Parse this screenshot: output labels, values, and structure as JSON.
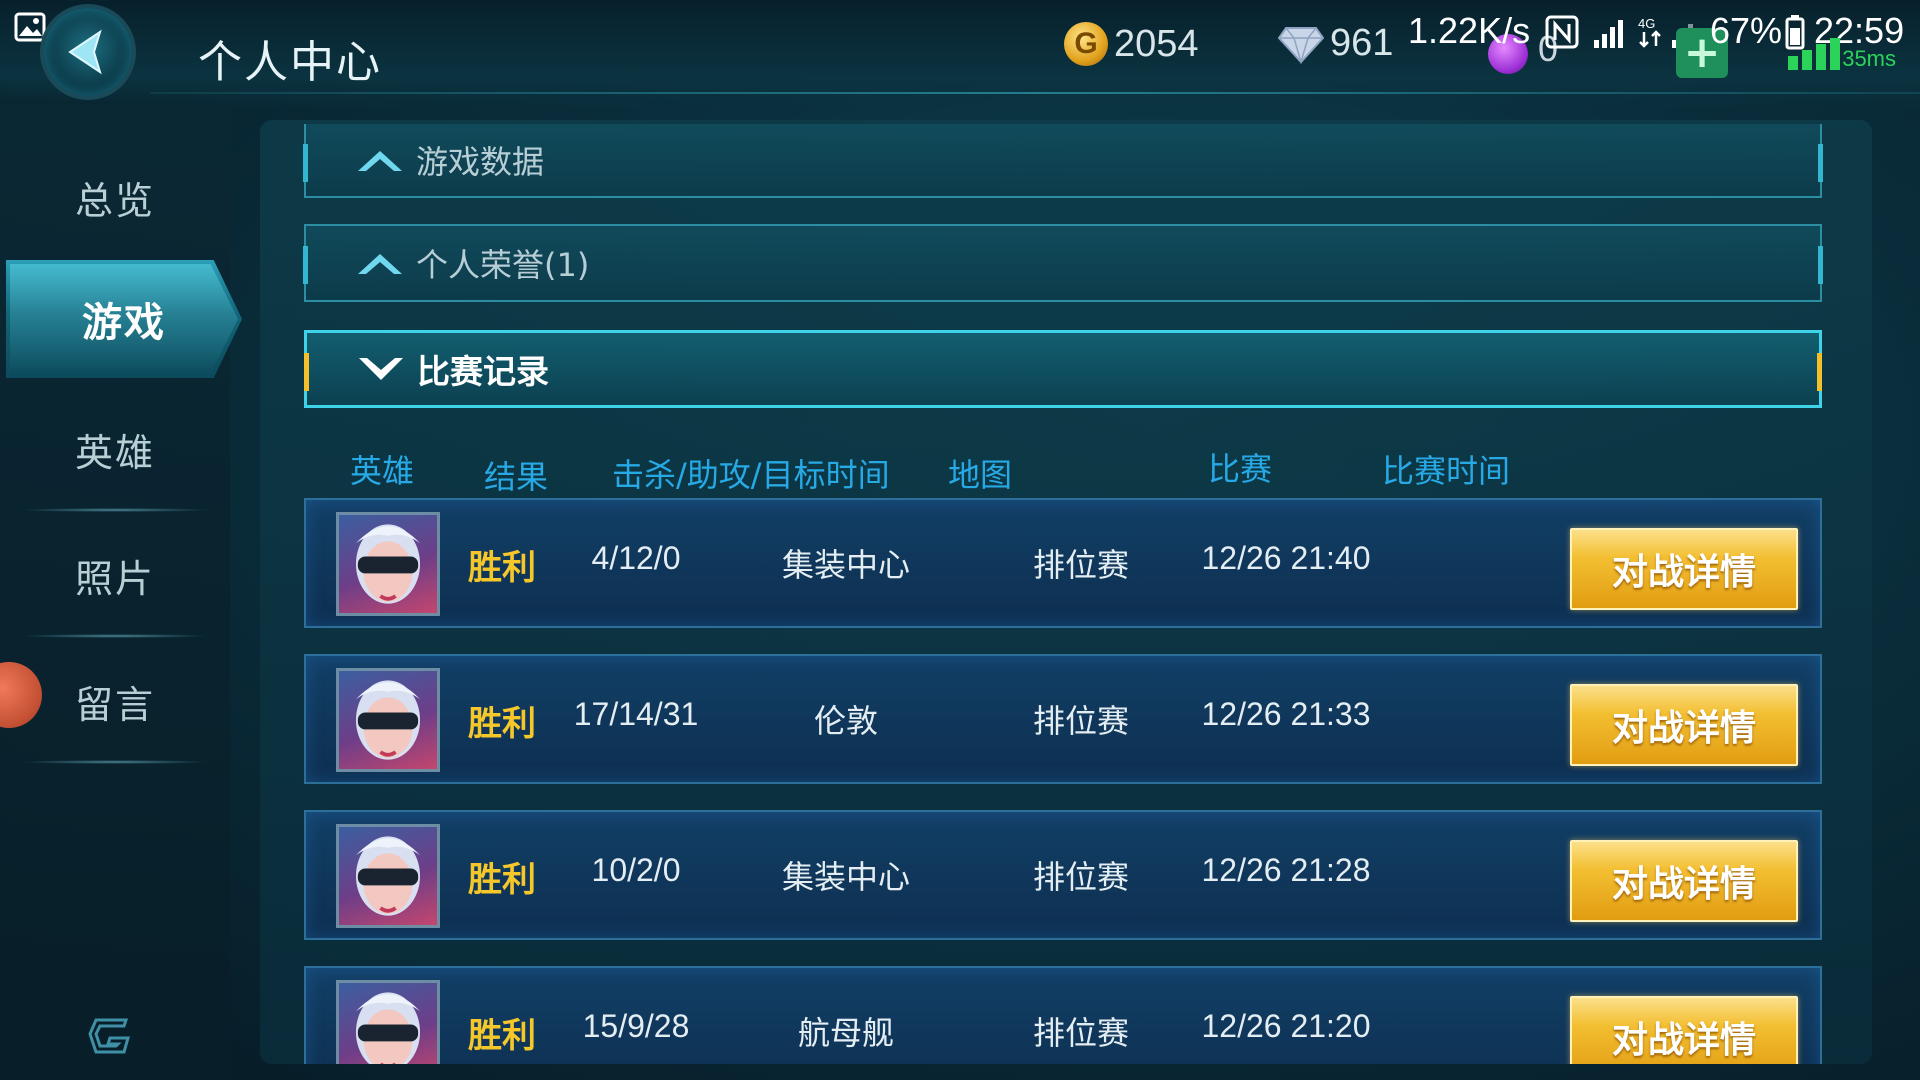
{
  "status_bar": {
    "net_speed": "1.22K/s",
    "battery": "67%",
    "time": "22:59",
    "ping": "35ms"
  },
  "header": {
    "title": "个人中心",
    "gold": "2054",
    "diamonds": "961",
    "purple_gems": "0"
  },
  "sidebar": {
    "items": [
      {
        "label": "总览"
      },
      {
        "label": "游戏"
      },
      {
        "label": "英雄"
      },
      {
        "label": "照片"
      },
      {
        "label": "留言"
      }
    ],
    "active_index": 1
  },
  "sections": [
    {
      "label": "游戏数据",
      "expanded": false
    },
    {
      "label": "个人荣誉(1)",
      "expanded": false
    },
    {
      "label": "比赛记录",
      "expanded": true
    }
  ],
  "match_table": {
    "headers": [
      "英雄",
      "结果",
      "击杀/助攻/目标时间",
      "地图",
      "比赛",
      "比赛时间"
    ],
    "rows": [
      {
        "result": "胜利",
        "kda": "4/12/0",
        "map": "集装中心",
        "mode": "排位赛",
        "time": "12/26 21:40",
        "button": "对战详情"
      },
      {
        "result": "胜利",
        "kda": "17/14/31",
        "map": "伦敦",
        "mode": "排位赛",
        "time": "12/26 21:33",
        "button": "对战详情"
      },
      {
        "result": "胜利",
        "kda": "10/2/0",
        "map": "集装中心",
        "mode": "排位赛",
        "time": "12/26 21:28",
        "button": "对战详情"
      },
      {
        "result": "胜利",
        "kda": "15/9/28",
        "map": "航母舰",
        "mode": "排位赛",
        "time": "12/26 21:20",
        "button": "对战详情"
      }
    ]
  },
  "colors": {
    "accent": "#3fd3ea",
    "result_win": "#f5c72a",
    "header_text": "#27a9e6",
    "button": "#f3bf32"
  }
}
